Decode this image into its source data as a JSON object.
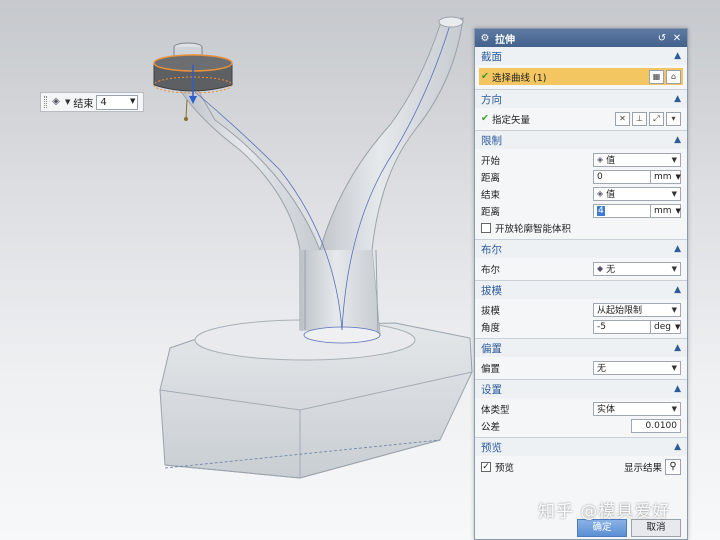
{
  "minibar": {
    "label": "结束",
    "value": "4"
  },
  "dialog": {
    "title": "拉伸",
    "sections": {
      "section_curve": {
        "title": "截面",
        "select_label": "选择曲线 (1)"
      },
      "section_direction": {
        "title": "方向",
        "vector_label": "指定矢量"
      },
      "section_limits": {
        "title": "限制",
        "start_label": "开始",
        "start_value": "值",
        "distance1_label": "距离",
        "distance1_value": "0",
        "distance1_unit": "mm",
        "end_label": "结束",
        "end_value": "值",
        "distance2_label": "距离",
        "distance2_value": "4",
        "distance2_unit": "mm",
        "open_profile_label": "开放轮廓智能体积"
      },
      "section_boolean": {
        "title": "布尔",
        "boolean_label": "布尔",
        "boolean_value": "无"
      },
      "section_draft": {
        "title": "拔模",
        "draft_label": "拔模",
        "draft_value": "从起始限制",
        "angle_label": "角度",
        "angle_value": "-5",
        "angle_unit": "deg"
      },
      "section_offset": {
        "title": "偏置",
        "offset_label": "偏置",
        "offset_value": "无"
      },
      "section_settings": {
        "title": "设置",
        "body_type_label": "体类型",
        "body_type_value": "实体",
        "tolerance_label": "公差",
        "tolerance_value": "0.0100"
      },
      "section_preview": {
        "title": "预览",
        "preview_label": "预览",
        "show_result_label": "显示结果"
      }
    },
    "ok_label": "确定",
    "cancel_label": "取消"
  },
  "watermark": "知乎 @模具爱好",
  "colors": {
    "title_bar": "#4a6b96",
    "section_title": "#2e5c9a",
    "selection_highlight": "#f3c661",
    "model_surface": "#d6dadf"
  }
}
